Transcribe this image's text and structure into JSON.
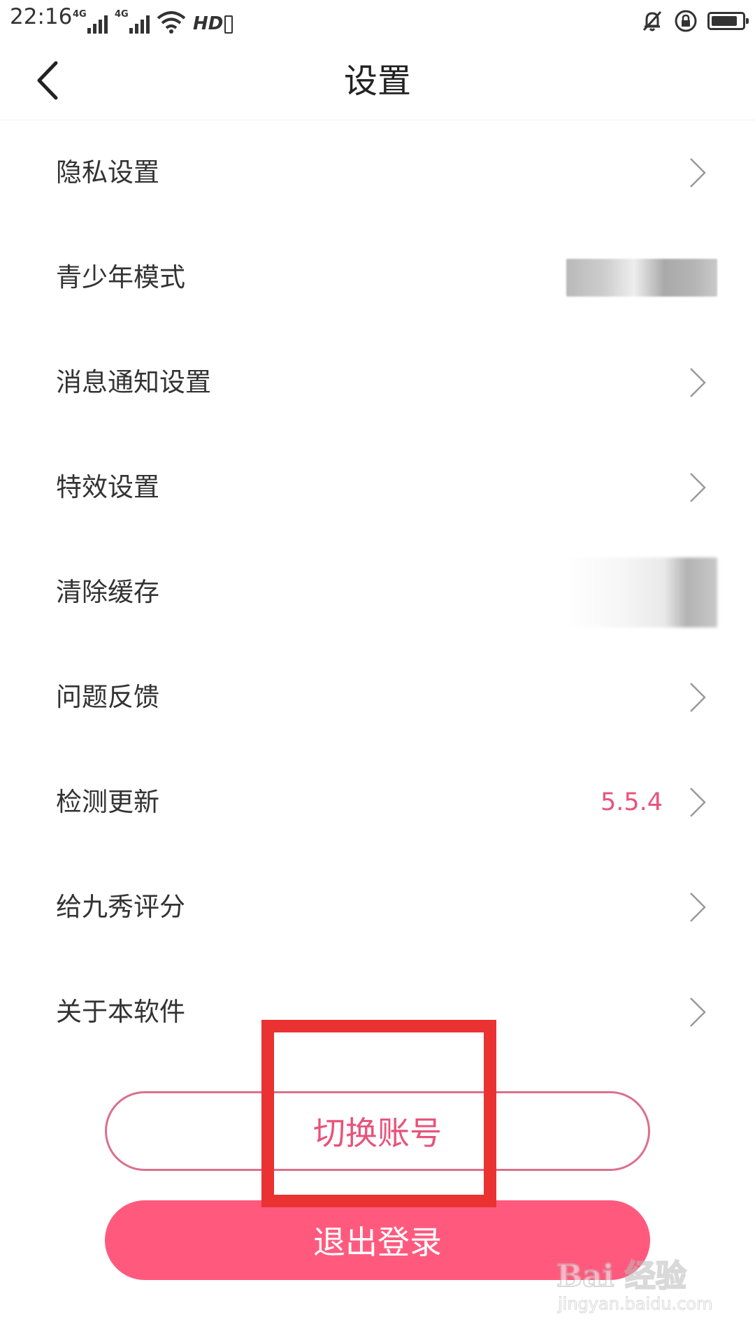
{
  "status_bar": {
    "time": "22:16",
    "network_1": "4G",
    "network_2": "4G",
    "hd_badge": "HD",
    "battery_level": 0.85,
    "icons": [
      "signal-icon",
      "signal-icon",
      "wifi-icon",
      "hd-icon",
      "mute-bell-icon",
      "rotation-lock-icon",
      "battery-icon"
    ]
  },
  "nav": {
    "title": "设置",
    "back_icon": "chevron-left-icon"
  },
  "settings": {
    "items": [
      {
        "label": "隐私设置"
      },
      {
        "label": "青少年模式"
      },
      {
        "label": "消息通知设置"
      },
      {
        "label": "特效设置"
      },
      {
        "label": "清除缓存"
      },
      {
        "label": "问题反馈"
      },
      {
        "label": "检测更新",
        "value": "5.5.4"
      },
      {
        "label": "给九秀评分"
      },
      {
        "label": "关于本软件"
      }
    ]
  },
  "buttons": {
    "switch_account": "切换账号",
    "logout": "退出登录"
  },
  "watermark": {
    "logo": "Bai 经验",
    "url": "jingyan.baidu.com"
  },
  "colors": {
    "accent": "#e8537a",
    "logout_bg": "#ff5a7e",
    "highlight": "#ea3233"
  }
}
